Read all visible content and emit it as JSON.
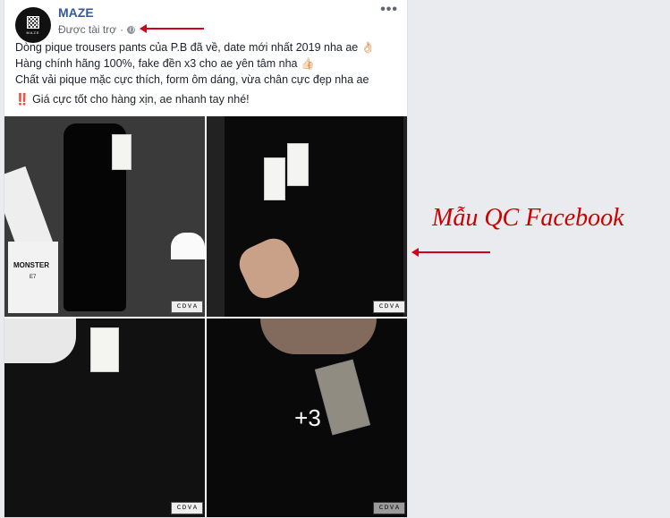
{
  "post": {
    "page_name": "MAZE",
    "logo_text": "MAZE",
    "sponsored_label": "Được tài trợ",
    "separator": "·",
    "more_options": "•••",
    "lines": [
      "Dòng pique trousers pants của P.B đã về, date mới nhất 2019 nha ae 👌🏻",
      "Hàng chính hãng 100%, fake đền x3 cho ae yên tâm nha 👍🏻",
      "Chất vải pique mặc cực thích, form ôm dáng, vừa chân cực đẹp nha ae"
    ],
    "highlight_icon": "‼️",
    "highlight_line": "Giá cực tốt cho hàng xịn, ae nhanh tay nhé!",
    "photos": {
      "p1_bag_label": "MONSTER",
      "p1_bag_sub": "E7",
      "badge": "ＣＤＶＡ",
      "more_count": "+3"
    }
  },
  "annotation": {
    "caption": "Mẫu QC Facebook"
  }
}
